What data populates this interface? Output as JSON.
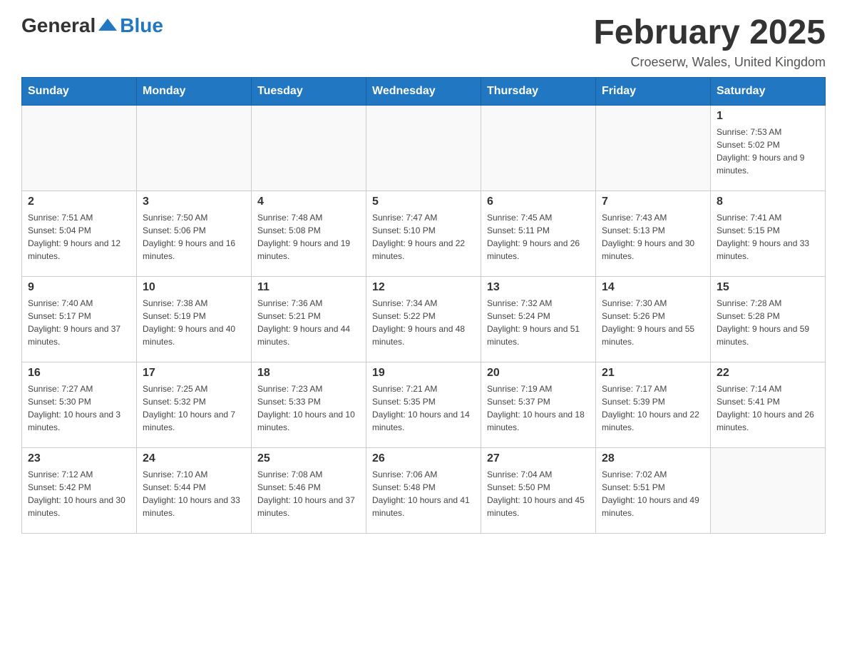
{
  "header": {
    "logo": {
      "text_general": "General",
      "text_blue": "Blue"
    },
    "title": "February 2025",
    "location": "Croeserw, Wales, United Kingdom"
  },
  "calendar": {
    "weekdays": [
      "Sunday",
      "Monday",
      "Tuesday",
      "Wednesday",
      "Thursday",
      "Friday",
      "Saturday"
    ],
    "weeks": [
      [
        {
          "day": "",
          "info": ""
        },
        {
          "day": "",
          "info": ""
        },
        {
          "day": "",
          "info": ""
        },
        {
          "day": "",
          "info": ""
        },
        {
          "day": "",
          "info": ""
        },
        {
          "day": "",
          "info": ""
        },
        {
          "day": "1",
          "info": "Sunrise: 7:53 AM\nSunset: 5:02 PM\nDaylight: 9 hours and 9 minutes."
        }
      ],
      [
        {
          "day": "2",
          "info": "Sunrise: 7:51 AM\nSunset: 5:04 PM\nDaylight: 9 hours and 12 minutes."
        },
        {
          "day": "3",
          "info": "Sunrise: 7:50 AM\nSunset: 5:06 PM\nDaylight: 9 hours and 16 minutes."
        },
        {
          "day": "4",
          "info": "Sunrise: 7:48 AM\nSunset: 5:08 PM\nDaylight: 9 hours and 19 minutes."
        },
        {
          "day": "5",
          "info": "Sunrise: 7:47 AM\nSunset: 5:10 PM\nDaylight: 9 hours and 22 minutes."
        },
        {
          "day": "6",
          "info": "Sunrise: 7:45 AM\nSunset: 5:11 PM\nDaylight: 9 hours and 26 minutes."
        },
        {
          "day": "7",
          "info": "Sunrise: 7:43 AM\nSunset: 5:13 PM\nDaylight: 9 hours and 30 minutes."
        },
        {
          "day": "8",
          "info": "Sunrise: 7:41 AM\nSunset: 5:15 PM\nDaylight: 9 hours and 33 minutes."
        }
      ],
      [
        {
          "day": "9",
          "info": "Sunrise: 7:40 AM\nSunset: 5:17 PM\nDaylight: 9 hours and 37 minutes."
        },
        {
          "day": "10",
          "info": "Sunrise: 7:38 AM\nSunset: 5:19 PM\nDaylight: 9 hours and 40 minutes."
        },
        {
          "day": "11",
          "info": "Sunrise: 7:36 AM\nSunset: 5:21 PM\nDaylight: 9 hours and 44 minutes."
        },
        {
          "day": "12",
          "info": "Sunrise: 7:34 AM\nSunset: 5:22 PM\nDaylight: 9 hours and 48 minutes."
        },
        {
          "day": "13",
          "info": "Sunrise: 7:32 AM\nSunset: 5:24 PM\nDaylight: 9 hours and 51 minutes."
        },
        {
          "day": "14",
          "info": "Sunrise: 7:30 AM\nSunset: 5:26 PM\nDaylight: 9 hours and 55 minutes."
        },
        {
          "day": "15",
          "info": "Sunrise: 7:28 AM\nSunset: 5:28 PM\nDaylight: 9 hours and 59 minutes."
        }
      ],
      [
        {
          "day": "16",
          "info": "Sunrise: 7:27 AM\nSunset: 5:30 PM\nDaylight: 10 hours and 3 minutes."
        },
        {
          "day": "17",
          "info": "Sunrise: 7:25 AM\nSunset: 5:32 PM\nDaylight: 10 hours and 7 minutes."
        },
        {
          "day": "18",
          "info": "Sunrise: 7:23 AM\nSunset: 5:33 PM\nDaylight: 10 hours and 10 minutes."
        },
        {
          "day": "19",
          "info": "Sunrise: 7:21 AM\nSunset: 5:35 PM\nDaylight: 10 hours and 14 minutes."
        },
        {
          "day": "20",
          "info": "Sunrise: 7:19 AM\nSunset: 5:37 PM\nDaylight: 10 hours and 18 minutes."
        },
        {
          "day": "21",
          "info": "Sunrise: 7:17 AM\nSunset: 5:39 PM\nDaylight: 10 hours and 22 minutes."
        },
        {
          "day": "22",
          "info": "Sunrise: 7:14 AM\nSunset: 5:41 PM\nDaylight: 10 hours and 26 minutes."
        }
      ],
      [
        {
          "day": "23",
          "info": "Sunrise: 7:12 AM\nSunset: 5:42 PM\nDaylight: 10 hours and 30 minutes."
        },
        {
          "day": "24",
          "info": "Sunrise: 7:10 AM\nSunset: 5:44 PM\nDaylight: 10 hours and 33 minutes."
        },
        {
          "day": "25",
          "info": "Sunrise: 7:08 AM\nSunset: 5:46 PM\nDaylight: 10 hours and 37 minutes."
        },
        {
          "day": "26",
          "info": "Sunrise: 7:06 AM\nSunset: 5:48 PM\nDaylight: 10 hours and 41 minutes."
        },
        {
          "day": "27",
          "info": "Sunrise: 7:04 AM\nSunset: 5:50 PM\nDaylight: 10 hours and 45 minutes."
        },
        {
          "day": "28",
          "info": "Sunrise: 7:02 AM\nSunset: 5:51 PM\nDaylight: 10 hours and 49 minutes."
        },
        {
          "day": "",
          "info": ""
        }
      ]
    ]
  }
}
